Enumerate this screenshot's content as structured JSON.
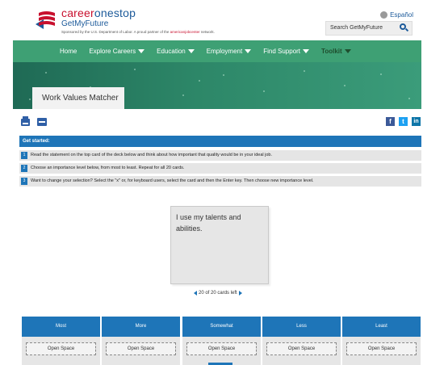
{
  "header": {
    "brand_part1": "career",
    "brand_part2": "onestop",
    "brand_sub": "GetMyFuture",
    "sponsor_text": "Sponsored by the U.S. Department of Labor. A proud partner of the",
    "sponsor_network": "americanjobcenter",
    "sponsor_end": "network.",
    "language_link": "Español",
    "search_placeholder": "Search GetMyFuture"
  },
  "nav": {
    "items": [
      {
        "label": "Home",
        "has_caret": false
      },
      {
        "label": "Explore Careers",
        "has_caret": true
      },
      {
        "label": "Education",
        "has_caret": true
      },
      {
        "label": "Employment",
        "has_caret": true
      },
      {
        "label": "Find Support",
        "has_caret": true
      },
      {
        "label": "Toolkit",
        "has_caret": true
      }
    ]
  },
  "banner": {
    "tab_label": "Work Values Matcher"
  },
  "social": {
    "facebook": "f",
    "twitter": "t",
    "linkedin": "in"
  },
  "instructions": {
    "heading": "Get started:",
    "steps": [
      {
        "num": "1",
        "text": "Read the statement on the top card of the deck below and think about how important that quality would be in your ideal job."
      },
      {
        "num": "2",
        "text": "Choose an importance level below, from most to least. Repeat for all 20 cards."
      },
      {
        "num": "3",
        "text": "Want to change your selection? Select the \"x\" or, for keyboard users, select the card and then the Enter key. Then choose new importance level."
      }
    ]
  },
  "card": {
    "text": "I use my talents and abilities.",
    "counter": "20 of 20 cards left"
  },
  "columns": [
    {
      "label": "Most",
      "slot": "Open Space"
    },
    {
      "label": "More",
      "slot": "Open Space"
    },
    {
      "label": "Somewhat",
      "slot": "Open Space"
    },
    {
      "label": "Less",
      "slot": "Open Space"
    },
    {
      "label": "Least",
      "slot": "Open Space"
    }
  ],
  "colors": {
    "accent_blue": "#1e75b8",
    "nav_green": "#3ea074",
    "brand_red": "#c8102e"
  }
}
